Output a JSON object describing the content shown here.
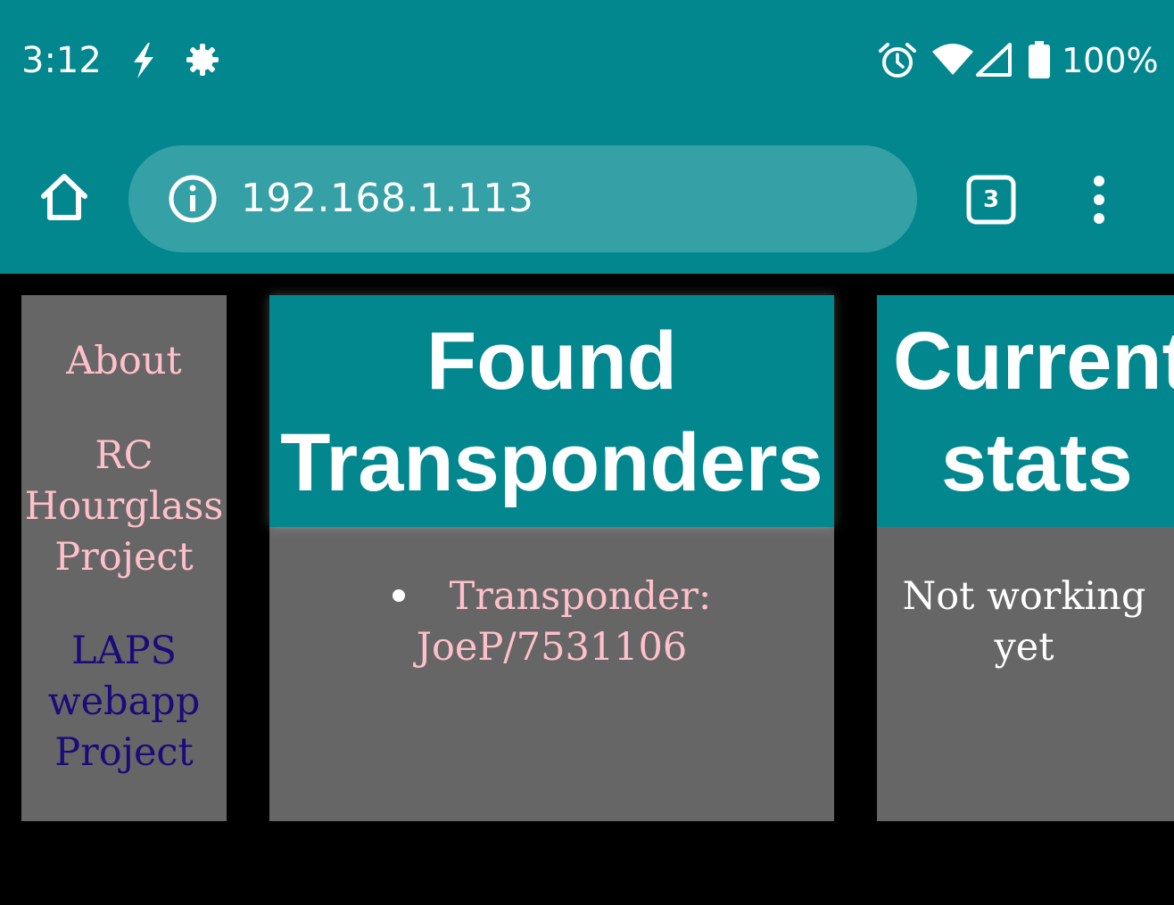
{
  "status_bar": {
    "time": "3:12",
    "battery": "100%",
    "left_icons": [
      "bolt-icon",
      "gear-icon"
    ],
    "right_icons": [
      "alarm-icon",
      "wifi-icon",
      "cell-signal-icon",
      "battery-icon"
    ]
  },
  "toolbar": {
    "url": "192.168.1.113",
    "tab_count": "3"
  },
  "sidebar": {
    "items": [
      {
        "label": "About"
      },
      {
        "label": "RC Hourglass Project"
      },
      {
        "label": "LAPS webapp Project"
      }
    ]
  },
  "found_panel": {
    "title_line1": "Found",
    "title_line2": "Transponders",
    "items": [
      {
        "text_line1": "Transponder:",
        "text_line2": "JoeP/7531106"
      }
    ]
  },
  "stats_panel": {
    "title_line1": "Current",
    "title_line2": "stats",
    "text_line1": "Not working",
    "text_line2": "yet"
  },
  "colors": {
    "accent": "#02878f",
    "url_bar": "#35a0a5",
    "panel_bg": "#666666",
    "page_bg": "#000000",
    "link_pink": "#ffc0cb",
    "link_navy": "#1a0a7a"
  }
}
